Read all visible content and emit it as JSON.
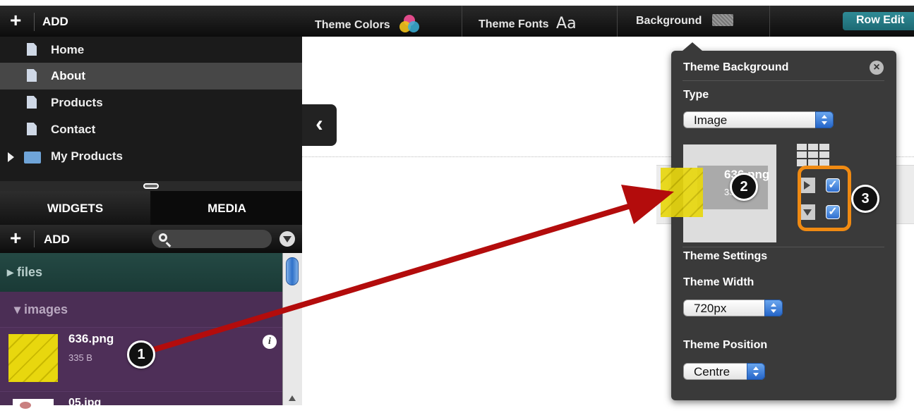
{
  "header": {
    "add_label": "ADD",
    "plus": "+"
  },
  "toolbar": {
    "theme_colors": "Theme Colors",
    "theme_fonts": "Theme Fonts",
    "theme_fonts_glyph": "Aa",
    "background": "Background",
    "row_edit": "Row Edit"
  },
  "pages": [
    {
      "label": "Home"
    },
    {
      "label": "About"
    },
    {
      "label": "Products"
    },
    {
      "label": "Contact"
    },
    {
      "label": "My Products"
    }
  ],
  "tabs": {
    "widgets": "WIDGETS",
    "media": "MEDIA"
  },
  "media": {
    "add_label": "ADD",
    "search_placeholder": "",
    "folders": {
      "files": "▸ files",
      "images": "▾ images"
    },
    "items": [
      {
        "name": "636.png",
        "size": "335 B"
      },
      {
        "name": "05.jpg"
      }
    ]
  },
  "panel": {
    "title": "Theme Background",
    "type_label": "Type",
    "type_value": "Image",
    "preview_name": "636.png",
    "preview_size": "335 B",
    "theme_settings": "Theme Settings",
    "theme_width_label": "Theme Width",
    "theme_width_value": "720px",
    "theme_position_label": "Theme Position",
    "theme_position_value": "Centre",
    "repeat_x_checked": true,
    "repeat_y_checked": true
  },
  "markers": [
    "1",
    "2",
    "3"
  ],
  "colors": {
    "accent_teal": "#2f8b96",
    "annotation_orange": "#f08a12",
    "annotation_arrow": "#b30c0c",
    "images_bg": "#4b2e55"
  }
}
